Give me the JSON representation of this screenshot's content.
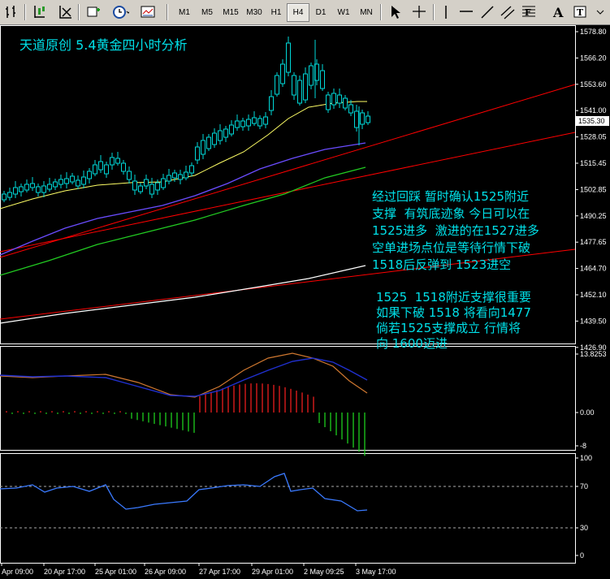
{
  "toolbar": {
    "timeframes": [
      "M1",
      "M5",
      "M15",
      "M30",
      "H1",
      "H4",
      "D1",
      "W1",
      "MN"
    ],
    "active_timeframe": "H4",
    "icons": [
      "chart-bars-icon",
      "candlesticks-icon",
      "line-chart-icon",
      "new-window-icon",
      "indicator-icon",
      "periods-icon",
      "templates-icon",
      "cursor-icon",
      "crosshair-icon",
      "vertical-line-icon",
      "horizontal-line-icon",
      "trendline-icon",
      "channel-icon",
      "fibonacci-icon",
      "text-icon",
      "label-icon"
    ]
  },
  "colors": {
    "background": "#000000",
    "candle": "#00d8d8",
    "text_overlay": "#00e0e8",
    "trendline": "#ff0000",
    "ma_fast": "#ffffff",
    "ma_mid": "#ffff66",
    "ma_blue": "#6a4cff",
    "ma_green": "#22cc22",
    "ma_slow": "#ffffff"
  },
  "main_chart": {
    "title": "天道原创 5.4黄金四小时分析",
    "price_labels": [
      "1578.80",
      "1566.20",
      "1553.60",
      "1541.00",
      "1528.05",
      "1515.45",
      "1502.85",
      "1490.25",
      "1477.65",
      "1464.70",
      "1452.10",
      "1439.50",
      "1426.90"
    ],
    "current_price": "1535.30",
    "analysis_1": "经过回踩 暂时确认1525附近\n支撑  有筑底迹象 今日可以在\n1525进多  激进的在1527进多\n空单进场点位是等待行情下破\n1518后反弹到 1523进空",
    "analysis_2": "1525  1518附近支撑很重要\n如果下破 1518 将看向1477\n倘若1525支撑成立 行情将\n向 1600迈进"
  },
  "macd_panel": {
    "labels": [
      "13.8253",
      "0.00",
      "-8"
    ]
  },
  "rsi_panel": {
    "labels": [
      "100",
      "70",
      "30",
      "0"
    ],
    "levels": [
      70,
      30
    ]
  },
  "time_axis": {
    "labels": [
      "Apr 09:00",
      "20 Apr 17:00",
      "25 Apr 01:00",
      "26 Apr 09:00",
      "27 Apr 17:00",
      "29 Apr 01:00",
      "2 May 09:25",
      "3 May 17:00"
    ]
  }
}
